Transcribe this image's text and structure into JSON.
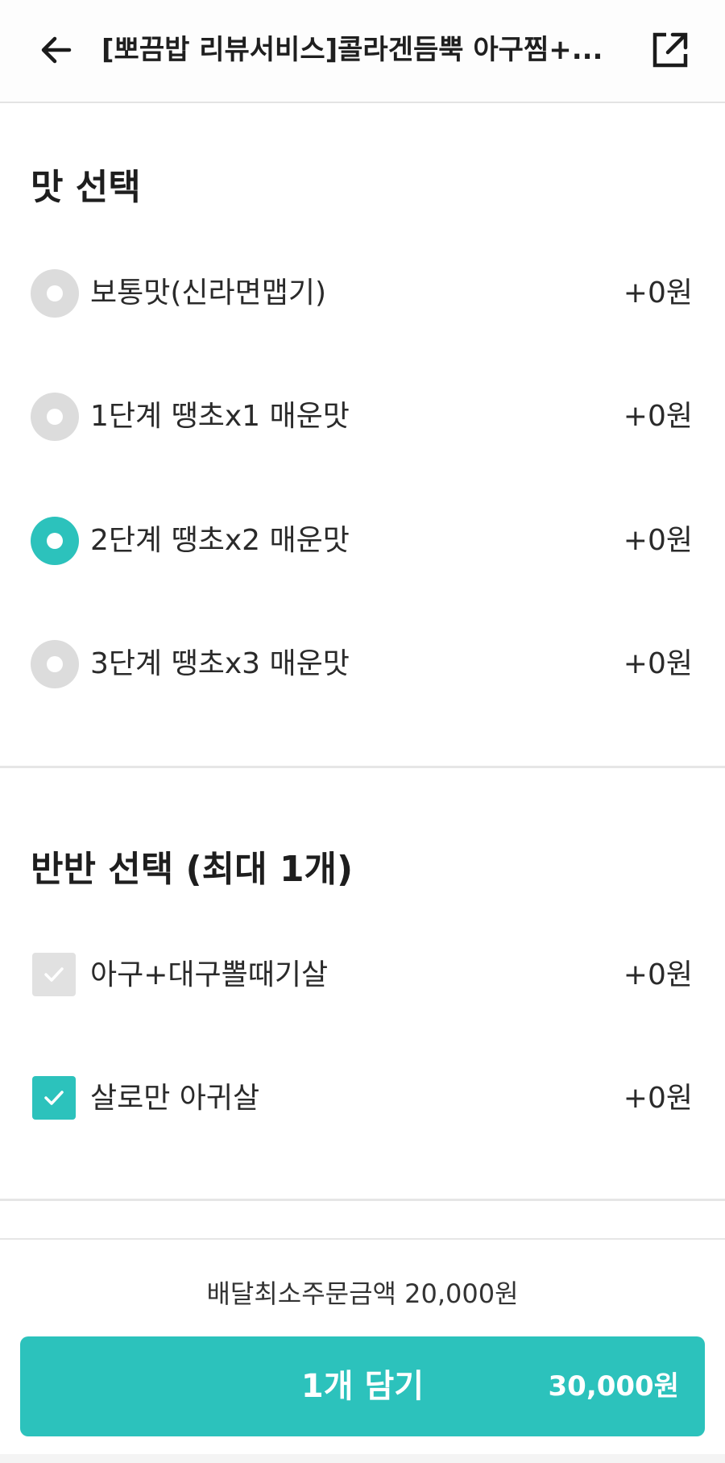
{
  "header": {
    "title": "[뽀끔밥 리뷰서비스]콜라겐듬뿍 아구찜+...",
    "back_icon": "arrow-left-icon",
    "share_icon": "share-external-icon"
  },
  "taste_section": {
    "title": "맛 선택",
    "options": [
      {
        "label": "보통맛(신라면맵기)",
        "price": "+0원",
        "selected": false
      },
      {
        "label": "1단계 땡초x1 매운맛",
        "price": "+0원",
        "selected": false
      },
      {
        "label": "2단계 땡초x2 매운맛",
        "price": "+0원",
        "selected": true
      },
      {
        "label": "3단계 땡초x3 매운맛",
        "price": "+0원",
        "selected": false
      }
    ]
  },
  "half_section": {
    "title": "반반 선택 (최대 1개)",
    "options": [
      {
        "label": "아구+대구뽈때기살",
        "price": "+0원",
        "checked": false
      },
      {
        "label": "살로만 아귀살",
        "price": "+0원",
        "checked": true
      }
    ]
  },
  "footer": {
    "min_order": "배달최소주문금액 20,000원",
    "cart_label": "1개 담기",
    "cart_price": "30,000원"
  },
  "colors": {
    "accent": "#2cc2bc",
    "unselected": "#dcdcdc"
  }
}
